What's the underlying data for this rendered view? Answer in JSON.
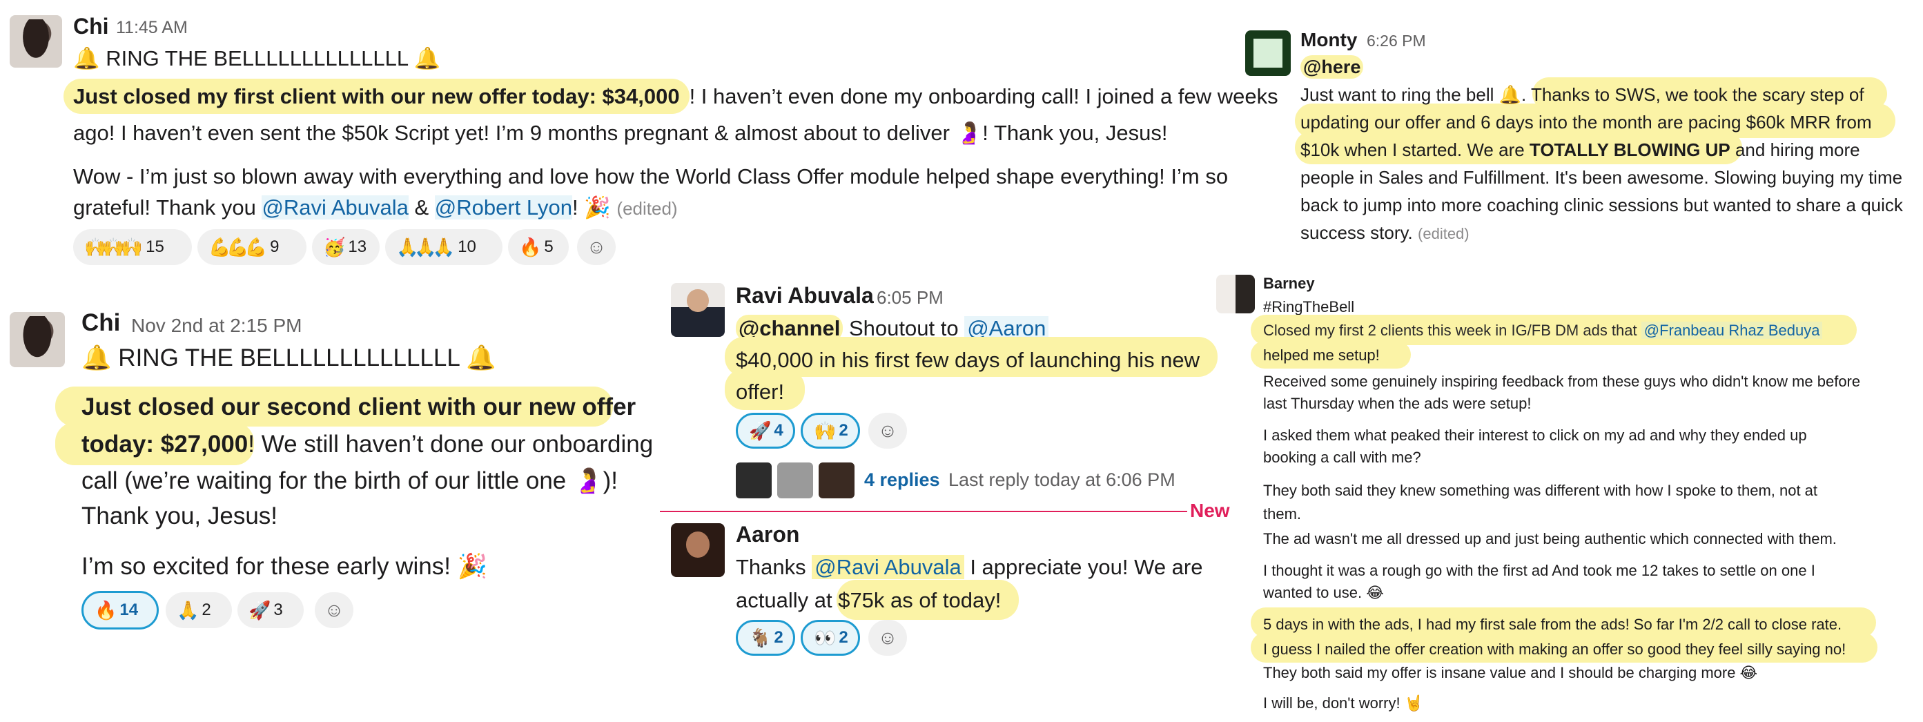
{
  "post_chi_1": {
    "author": "Chi",
    "time": "11:45 AM",
    "title": "🔔 RING THE BELLLLLLLLLLLLLL 🔔",
    "highlight": "Just closed my first client with our new offer today: $34,000",
    "text_after_highlight": "! I haven’t even done my onboarding call! I joined a few weeks",
    "line2": "ago! I haven’t even sent the $50k Script yet! I’m 9 months pregnant & almost about to deliver 🤰! Thank you, Jesus!",
    "line3": "Wow - I’m just so blown away with everything and love how the World Class Offer module helped shape everything! I’m so",
    "line4_a": "grateful! Thank you ",
    "mention_1": "@Ravi Abuvala",
    "line4_b": " & ",
    "mention_2": "@Robert Lyon",
    "line4_c": "! 🎉",
    "edited": "(edited)",
    "reactions": [
      {
        "emoji": "🙌🙌🙌",
        "count": "15"
      },
      {
        "emoji": "💪💪💪",
        "count": "9"
      },
      {
        "emoji": "🥳",
        "count": "13"
      },
      {
        "emoji": "🙏🙏🙏",
        "count": "10"
      },
      {
        "emoji": "🔥",
        "count": "5"
      }
    ]
  },
  "post_chi_2": {
    "author": "Chi",
    "time": "Nov 2nd at 2:15 PM",
    "title": "🔔 RING THE BELLLLLLLLLLLLLL 🔔",
    "highlight_1": "Just closed our second client with our new offer",
    "highlight_2": "today: $27,000",
    "line2_rest": "! We still haven’t done our onboarding",
    "line3": "call (we’re waiting for the birth of our little one 🤰)!",
    "line4": "Thank you, Jesus!",
    "line5": "I’m so excited for these early wins! 🎉",
    "reactions": [
      {
        "emoji": "🔥",
        "count": "14"
      },
      {
        "emoji": "🙏",
        "count": "2"
      },
      {
        "emoji": "🚀",
        "count": "3"
      }
    ]
  },
  "post_ravi": {
    "author": "Ravi Abuvala",
    "time": "6:05 PM",
    "channel": "@channel",
    "shoutout": " Shoutout to ",
    "mention": "@Aaron",
    "highlight_1": "$40,000 in his first few days of launching his new",
    "highlight_2": "offer!",
    "reactions": [
      {
        "emoji": "🚀",
        "count": "4"
      },
      {
        "emoji": "🙌",
        "count": "2"
      }
    ],
    "replies": "4 replies",
    "last_reply": "Last reply today at 6:06 PM",
    "new_label": "New"
  },
  "post_aaron": {
    "author": "Aaron",
    "line1_a": "Thanks ",
    "mention": "@Ravi Abuvala",
    "line1_b": " I appreciate you! We are",
    "line2_a": "actually at ",
    "highlight": "$75k as of today!",
    "reactions": [
      {
        "emoji": "🐐",
        "count": "2"
      },
      {
        "emoji": "👀",
        "count": "2"
      }
    ]
  },
  "post_monty": {
    "author": "Monty",
    "time": "6:26 PM",
    "here": "@here",
    "line1_a": "Just want to ring the bell 🔔. ",
    "line1_hl": "Thanks to SWS, we took the scary step of",
    "line2_hl": "updating our offer and 6 days into the month are pacing $60k MRR from",
    "line3_hl_a": "$10k when I started. We are ",
    "line3_hl_b": "TOTALLY BLOWING UP",
    "line3_rest": " and hiring more",
    "line4": "people in Sales and Fulfillment. It's been awesome. Slowing buying my time",
    "line5": "back to jump into more coaching clinic sessions but wanted to share a quick",
    "line6": "success story. ",
    "edited": "(edited)"
  },
  "post_barney": {
    "author": "Barney",
    "tag": "#RingTheBell",
    "hl1_a": "Closed my first 2 clients this week in IG/FB DM ads that ",
    "hl1_mention": "@Franbeau Rhaz Beduya",
    "hl2": "helped me setup!",
    "p1": "Received some genuinely inspiring feedback from these guys who didn't know me before",
    "p1b": "last Thursday when the ads were setup!",
    "p2": "I asked them what peaked their interest to click on my ad and why they ended up",
    "p2b": "booking a call with me?",
    "p3": "They both said they knew something was different with how I spoke to them, not at",
    "p3b": "them.",
    "p4": "The ad wasn't me all dressed up and just being authentic which connected with them.",
    "p5": "I thought it was a rough go with the first ad And took me 12 takes to settle on one I",
    "p5b": "wanted to use. 😂",
    "hl3": "5 days in with the ads, I had my first sale from the ads! So far I'm 2/2 call to close rate.",
    "hl4": "I guess I nailed the offer creation with making an offer so good they feel silly saying no!",
    "p6": "They both said my offer is insane value and I should be charging more 😂",
    "p7": "I will be, don't worry! 🤘"
  },
  "colors": {
    "highlight": "#fbf3a6",
    "mention": "#1264a3",
    "new_divider": "#e01e5a",
    "reaction_bg": "#f0f0f0"
  }
}
